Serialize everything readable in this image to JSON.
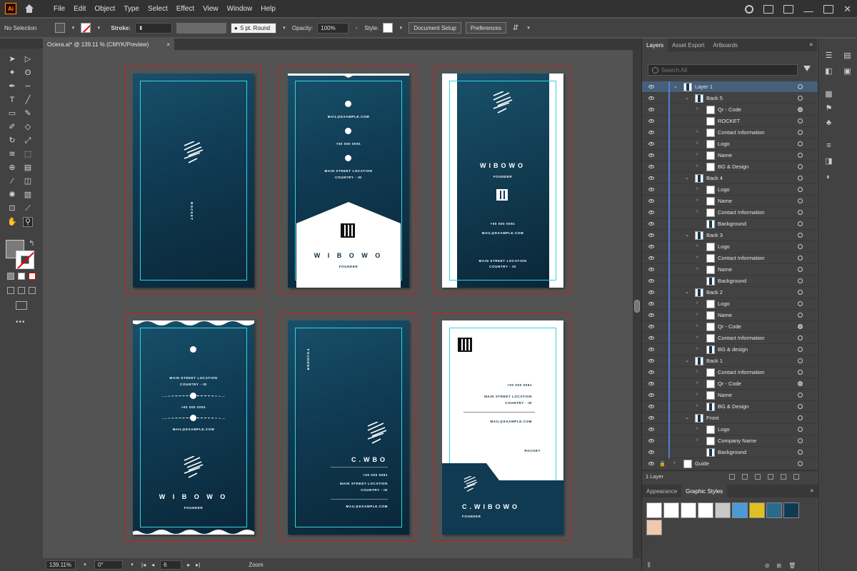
{
  "app": {
    "logo": "Ai",
    "home_icon": "home-icon"
  },
  "menu": [
    "File",
    "Edit",
    "Object",
    "Type",
    "Select",
    "Effect",
    "View",
    "Window",
    "Help"
  ],
  "control": {
    "selection": "No Selection",
    "stroke_label": "Stroke:",
    "brush": "5 pt. Round",
    "opacity_label": "Opacity:",
    "opacity": "100%",
    "style_label": "Style:",
    "doc_setup": "Document Setup",
    "preferences": "Preferences"
  },
  "document": {
    "tab_title": "Ociera.ai* @ 139.11 % (CMYK/Preview)",
    "close": "×"
  },
  "status": {
    "zoom": "139.11%",
    "rotation": "0°",
    "artboard": "6",
    "tool": "Zoom"
  },
  "cards": {
    "rocket": "ROCKET",
    "email": "MAIL@EXAMPLE.COM",
    "phone": "+00 000 0091",
    "address1": "MAIN STREET LOCATION",
    "address2": "COUNTRY - ID",
    "name1": "WIBOWO",
    "name1_spaced": "W I B O W O",
    "title": "FOUNDER",
    "founder_vertical": "FOUNDER",
    "name2": "C.WBO",
    "name3": "C.WIBOWO"
  },
  "panel": {
    "tabs": [
      "Layers",
      "Asset Export",
      "Artboards"
    ],
    "search_placeholder": "Search All",
    "layers": [
      {
        "name": "Layer 1",
        "depth": 0,
        "open": true,
        "sel": true,
        "thumb": "dk"
      },
      {
        "name": "Back 5",
        "depth": 1,
        "open": true,
        "thumb": "dk"
      },
      {
        "name": "Qr - Code",
        "depth": 2,
        "arrow": true,
        "thumb": "w",
        "filled": true
      },
      {
        "name": "ROCKET",
        "depth": 2,
        "thumb": "w"
      },
      {
        "name": "Contact Information",
        "depth": 2,
        "arrow": true,
        "thumb": "w"
      },
      {
        "name": "Logo",
        "depth": 2,
        "arrow": true,
        "thumb": "w"
      },
      {
        "name": "Name",
        "depth": 2,
        "arrow": true,
        "thumb": "w"
      },
      {
        "name": "BG & Design",
        "depth": 2,
        "arrow": true,
        "thumb": "w"
      },
      {
        "name": "Back 4",
        "depth": 1,
        "open": true,
        "thumb": "dk"
      },
      {
        "name": "Logo",
        "depth": 2,
        "arrow": true,
        "thumb": "w"
      },
      {
        "name": "Name",
        "depth": 2,
        "arrow": true,
        "thumb": "w"
      },
      {
        "name": "Contact Information",
        "depth": 2,
        "arrow": true,
        "thumb": "w"
      },
      {
        "name": "Background",
        "depth": 2,
        "thumb": "dk"
      },
      {
        "name": "Back 3",
        "depth": 1,
        "open": true,
        "thumb": "dk"
      },
      {
        "name": "Logo",
        "depth": 2,
        "arrow": true,
        "thumb": "w"
      },
      {
        "name": "Contact Information",
        "depth": 2,
        "arrow": true,
        "thumb": "w"
      },
      {
        "name": "Name",
        "depth": 2,
        "arrow": true,
        "thumb": "w"
      },
      {
        "name": "Background",
        "depth": 2,
        "thumb": "dk"
      },
      {
        "name": "Back 2",
        "depth": 1,
        "open": true,
        "thumb": "dk"
      },
      {
        "name": "Logo",
        "depth": 2,
        "arrow": true,
        "thumb": "w"
      },
      {
        "name": "Name",
        "depth": 2,
        "arrow": true,
        "thumb": "w"
      },
      {
        "name": "Qr - Code",
        "depth": 2,
        "arrow": true,
        "thumb": "w",
        "filled": true
      },
      {
        "name": "Contact Information",
        "depth": 2,
        "arrow": true,
        "thumb": "w"
      },
      {
        "name": "BG & design",
        "depth": 2,
        "arrow": true,
        "thumb": "dk"
      },
      {
        "name": "Back 1",
        "depth": 1,
        "open": true,
        "thumb": "dk"
      },
      {
        "name": "Contact Information",
        "depth": 2,
        "arrow": true,
        "thumb": "w"
      },
      {
        "name": "Qr - Code",
        "depth": 2,
        "arrow": true,
        "thumb": "w",
        "filled": true
      },
      {
        "name": "Name",
        "depth": 2,
        "arrow": true,
        "thumb": "w"
      },
      {
        "name": "BG & Design",
        "depth": 2,
        "arrow": true,
        "thumb": "dk"
      },
      {
        "name": "Front",
        "depth": 1,
        "open": true,
        "thumb": "dk"
      },
      {
        "name": "Logo",
        "depth": 2,
        "arrow": true,
        "thumb": "w"
      },
      {
        "name": "Company Name",
        "depth": 2,
        "arrow": true,
        "thumb": "w"
      },
      {
        "name": "Background",
        "depth": 2,
        "thumb": "dk"
      },
      {
        "name": "Guide",
        "depth": 0,
        "arrow": true,
        "lock": true,
        "thumb": "w"
      }
    ],
    "layer_count": "1 Layer",
    "tabs2": [
      "Appearance",
      "Graphic Styles"
    ]
  },
  "graphic_styles": [
    "#ffffff",
    "#ffffff",
    "#ffffff",
    "#ffffff",
    "#c8c8c8",
    "#4a9ad8",
    "#e0c020",
    "#2a6a8a",
    "#0f3a52",
    "#f0c8b0"
  ]
}
